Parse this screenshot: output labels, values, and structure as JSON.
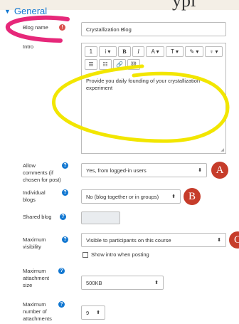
{
  "section": {
    "title": "General"
  },
  "fields": {
    "blog_name": {
      "label": "Blog name",
      "value": "Crystallization Blog"
    },
    "intro": {
      "label": "Intro",
      "text": "Provide you daily founding of your crystallization experiment"
    },
    "allow_comments": {
      "label_lines": [
        "Allow",
        "comments (if",
        "chosen for post)"
      ],
      "value": "Yes, from logged-in users"
    },
    "individual_blogs": {
      "label_lines": [
        "Individual",
        "blogs"
      ],
      "value": "No (blog together or in groups)"
    },
    "shared_blog": {
      "label": "Shared blog",
      "value": ""
    },
    "max_visibility": {
      "label_lines": [
        "Maximum",
        "visibility"
      ],
      "value": "Visible to participants on this course"
    },
    "show_intro": {
      "label": "Show intro when posting"
    },
    "max_attachment_size": {
      "label_lines": [
        "Maximum",
        "attachment",
        "size"
      ],
      "value": "500KB"
    },
    "max_attachments": {
      "label_lines": [
        "Maximum",
        "number of",
        "attachments"
      ],
      "value": "9"
    }
  },
  "toolbar": {
    "row1": [
      "1",
      "i ▾",
      "B",
      "I",
      "A ▾",
      "T ▾",
      "✎ ▾",
      "♀ ▾"
    ],
    "row2": [
      "☰",
      "☷",
      "🔗",
      "⛓"
    ]
  },
  "icons": {
    "help": "question-icon",
    "required": "required-icon"
  },
  "badges": {
    "a": "A",
    "b": "B",
    "c": "C"
  },
  "top_glyph": "ypi",
  "colors": {
    "accent": "#1177d1",
    "badge": "#c63c2a",
    "pink_marker": "#e6287a",
    "yellow_marker": "#f2e600"
  }
}
